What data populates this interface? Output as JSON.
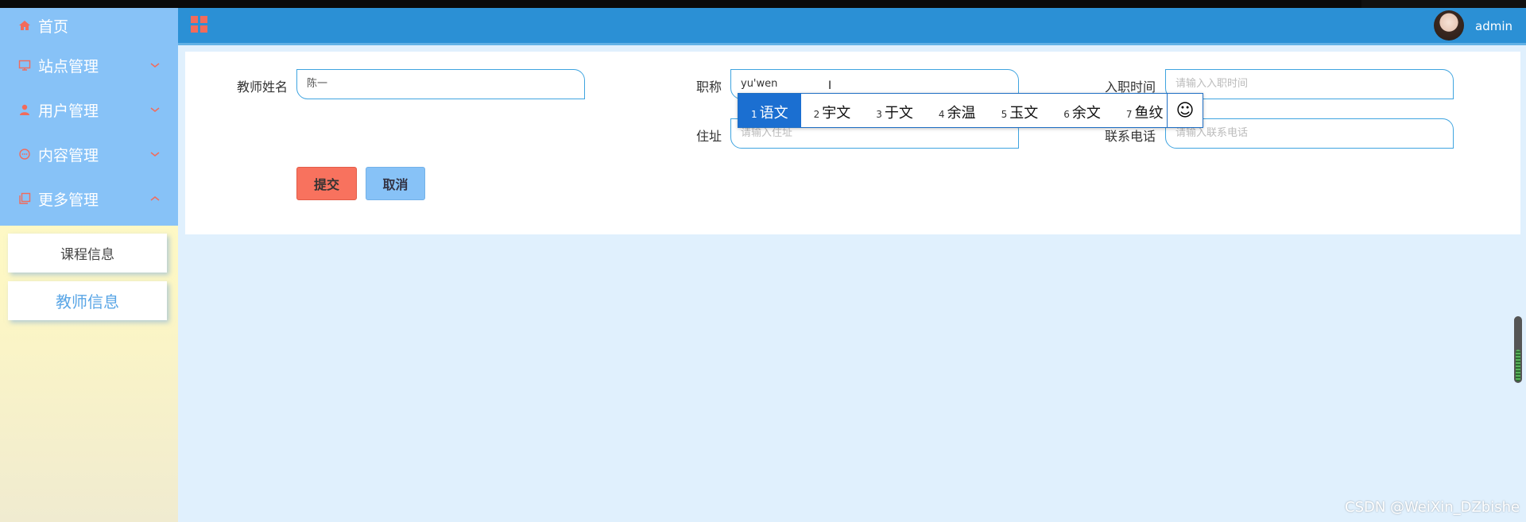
{
  "header": {
    "username": "admin"
  },
  "sidebar": {
    "items": [
      {
        "label": "首页",
        "icon": "home-icon"
      },
      {
        "label": "站点管理",
        "icon": "monitor-icon"
      },
      {
        "label": "用户管理",
        "icon": "user-icon"
      },
      {
        "label": "内容管理",
        "icon": "chat-icon"
      },
      {
        "label": "更多管理",
        "icon": "copy-icon"
      }
    ],
    "submenu": [
      {
        "label": "课程信息"
      },
      {
        "label": "教师信息",
        "active": true
      }
    ]
  },
  "form": {
    "teacher_name": {
      "label": "教师姓名",
      "value": "陈一"
    },
    "title": {
      "label": "职称",
      "value": "yu'wen"
    },
    "hire_date": {
      "label": "入职时间",
      "placeholder": "请输入入职时间"
    },
    "address": {
      "label": "住址",
      "placeholder": "请输入住址"
    },
    "phone": {
      "label": "联系电话",
      "placeholder": "请输入联系电话"
    },
    "submit_label": "提交",
    "cancel_label": "取消"
  },
  "ime": {
    "candidates": [
      {
        "num": "1",
        "text": "语文"
      },
      {
        "num": "2",
        "text": "宇文"
      },
      {
        "num": "3",
        "text": "于文"
      },
      {
        "num": "4",
        "text": "余温"
      },
      {
        "num": "5",
        "text": "玉文"
      },
      {
        "num": "6",
        "text": "余文"
      },
      {
        "num": "7",
        "text": "鱼纹"
      }
    ],
    "emoji_symbol": "☺"
  },
  "cursor_symbol": "I",
  "watermark": "CSDN @WeiXin_DZbishe",
  "colors": {
    "accent": "#2b90d5",
    "sidebar_menu": "#87c2f7",
    "submit": "#f8725e",
    "input_border": "#3fa4e0"
  }
}
